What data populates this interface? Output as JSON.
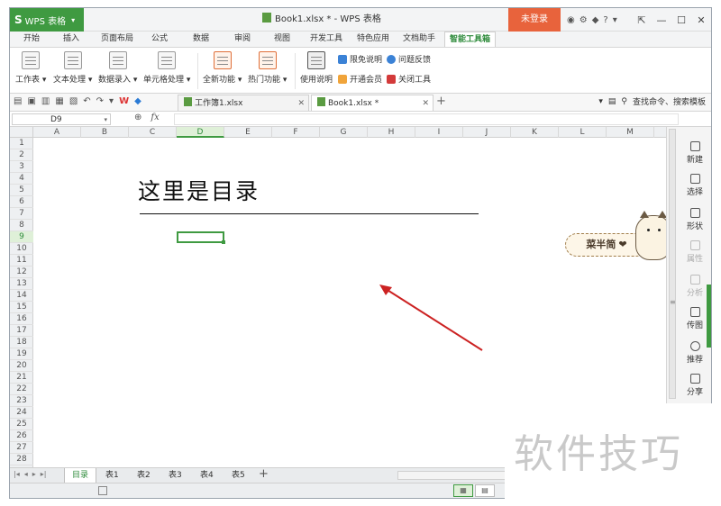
{
  "app": {
    "menu_button": "WPS 表格",
    "logo_letter": "S",
    "window_title": "Book1.xlsx * - WPS 表格",
    "login_button": "未登录",
    "help_icon": "?"
  },
  "menu_tabs": [
    "开始",
    "插入",
    "页面布局",
    "公式",
    "数据",
    "审阅",
    "视图",
    "开发工具",
    "特色应用",
    "文档助手",
    "智能工具箱"
  ],
  "ribbon": {
    "buttons": [
      "工作表",
      "文本处理",
      "数据录入",
      "单元格处理",
      "全新功能",
      "热门功能",
      "使用说明"
    ],
    "small_items": [
      "限免说明",
      "问题反馈",
      "开通会员",
      "关闭工具"
    ]
  },
  "doc_tabs": [
    {
      "label": "工作簿1.xlsx",
      "active": false
    },
    {
      "label": "Book1.xlsx *",
      "active": true
    }
  ],
  "search_placeholder": "查找命令、搜索模板",
  "formula_bar": {
    "name_box": "D9",
    "fx_label": "fx",
    "formula_value": ""
  },
  "columns": [
    "A",
    "B",
    "C",
    "D",
    "E",
    "F",
    "G",
    "H",
    "I",
    "J",
    "K",
    "L",
    "M"
  ],
  "rows": [
    "1",
    "2",
    "3",
    "4",
    "5",
    "6",
    "7",
    "8",
    "9",
    "10",
    "11",
    "12",
    "13",
    "14",
    "15",
    "16",
    "17",
    "18",
    "19",
    "20",
    "21",
    "22",
    "23",
    "24",
    "25",
    "26",
    "27",
    "28"
  ],
  "selected_cell": {
    "column": "D",
    "row": "9"
  },
  "sheet_content": {
    "heading": "这里是目录"
  },
  "sticker": {
    "text": "菜半简",
    "heart": "❤"
  },
  "right_panel": {
    "items": [
      {
        "label": "新建",
        "enabled": true
      },
      {
        "label": "选择",
        "enabled": true
      },
      {
        "label": "形状",
        "enabled": true
      },
      {
        "label": "属性",
        "enabled": false
      },
      {
        "label": "分析",
        "enabled": false
      },
      {
        "label": "传图",
        "enabled": true
      },
      {
        "label": "推荐",
        "enabled": true
      },
      {
        "label": "分享",
        "enabled": true
      }
    ]
  },
  "sheet_tabs": [
    "目录",
    "表1",
    "表2",
    "表3",
    "表4",
    "表5"
  ],
  "active_sheet": "目录",
  "watermark": "软件技巧",
  "colors": {
    "accent_green": "#3f9a41",
    "login_orange": "#e8633c",
    "arrow_red": "#cc2222"
  }
}
